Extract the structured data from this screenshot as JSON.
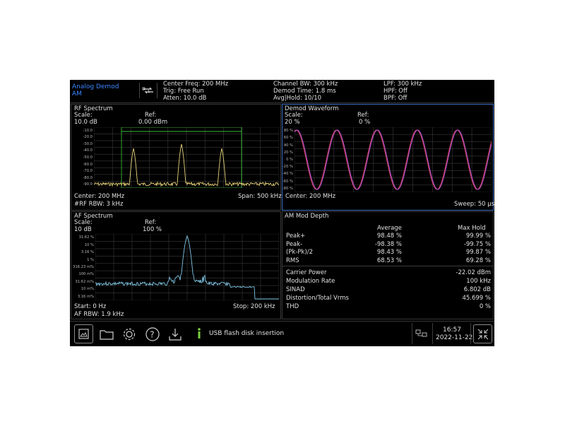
{
  "header": {
    "mode_line1": "Analog Demod",
    "mode_line2": "AM",
    "center_freq": "Center Freq: 200 MHz",
    "trig": "Trig: Free Run",
    "atten": "Atten: 10.0 dB",
    "channel_bw": "Channel BW: 300 kHz",
    "demod_time": "Demod Time: 1.8 ms",
    "avg_hold": "Avg|Hold: 10/10",
    "lpf": "LPF: 300 kHz",
    "hpf": "HPF: Off",
    "bpf": "BPF: Off"
  },
  "rf": {
    "title": "RF Spectrum",
    "scale_label": "Scale:",
    "scale_value": "10.0 dB",
    "ref_label": "Ref:",
    "ref_value": "0.00 dBm",
    "center": "Center: 200 MHz",
    "rbw": "#RF RBW: 3 kHz",
    "span": "Span: 500 kHz",
    "y_ticks": [
      "-10.0",
      "-20.0",
      "-30.0",
      "-40.0",
      "-50.0",
      "-60.0",
      "-70.0",
      "-80.0",
      "-90.0"
    ]
  },
  "demod": {
    "title": "Demod Waveform",
    "scale_label": "Scale:",
    "scale_value": "20 %",
    "ref_label": "Ref:",
    "ref_value": "0 %",
    "center": "Center: 200 MHz",
    "sweep": "Sweep: 50 μs",
    "y_ticks": [
      "80 %",
      "60 %",
      "40 %",
      "20 %",
      "0 %",
      "-20 %",
      "-40 %",
      "-60 %",
      "-80 %"
    ]
  },
  "af": {
    "title": "AF Spectrum",
    "scale_label": "Scale:",
    "scale_value": "10 dB",
    "ref_label": "Ref:",
    "ref_value": "100 %",
    "start": "Start: 0 Hz",
    "rbw": "AF RBW: 1.9 kHz",
    "stop": "Stop: 200 kHz",
    "y_ticks": [
      "31.62 %",
      "10 %",
      "3.16 %",
      "1 %",
      "316.23 m%",
      "100 m%",
      "31.62 m%",
      "10 m%",
      "3.16 m%"
    ]
  },
  "mod": {
    "title": "AM Mod Depth",
    "col_average": "Average",
    "col_maxhold": "Max Hold",
    "rows": [
      {
        "label": "Peak+",
        "avg": "98.48 %",
        "max": "99.99 %"
      },
      {
        "label": "Peak-",
        "avg": "-98.38 %",
        "max": "-99.75 %"
      },
      {
        "label": "(Pk-Pk)/2",
        "avg": "98.43 %",
        "max": "99.87 %"
      },
      {
        "label": "RMS",
        "avg": "68.53 %",
        "max": "69.28 %"
      }
    ],
    "metrics": [
      {
        "label": "Carrier Power",
        "value": "-22.02 dBm"
      },
      {
        "label": "Modulation Rate",
        "value": "100 kHz"
      },
      {
        "label": "SINAD",
        "value": "6.802 dB"
      },
      {
        "label": "Distortion/Total Vrms",
        "value": "45.699 %"
      },
      {
        "label": "THD",
        "value": "0 %"
      }
    ]
  },
  "status": {
    "message": "USB flash disk insertion",
    "time": "16:57",
    "date": "2022-11-22"
  },
  "toolbar": {
    "icons": [
      "screenshot-icon",
      "folder-icon",
      "gear-icon",
      "help-icon",
      "download-icon"
    ]
  },
  "colors": {
    "accent_blue": "#3a86ff",
    "trace_yellow": "#e6d27a",
    "trace_cyan": "#7fc6e6",
    "trace_red": "#d0405a",
    "trace_magenta": "#a84fc8",
    "marker_green": "#3cb83c",
    "info_green": "#7ad040"
  }
}
